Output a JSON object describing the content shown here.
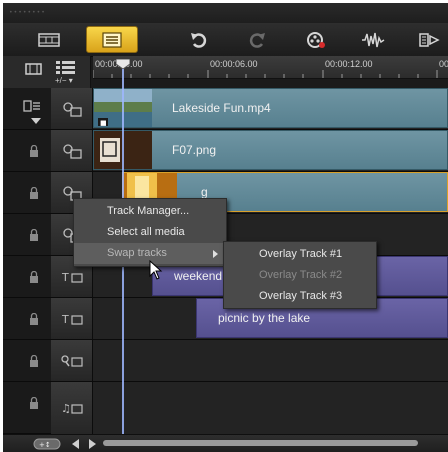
{
  "toolbar": {
    "buttons": [
      {
        "name": "storyboard-view-icon",
        "active": false
      },
      {
        "name": "timeline-view-icon",
        "active": true
      },
      {
        "name": "undo-icon",
        "active": false
      },
      {
        "name": "redo-icon",
        "active": false
      },
      {
        "name": "record-capture-icon",
        "active": false
      },
      {
        "name": "sound-mixer-icon",
        "active": false
      },
      {
        "name": "auto-music-icon",
        "active": false
      }
    ]
  },
  "ruler": {
    "add_remove_label": "+/− ▾",
    "timecodes": [
      "00:00:00.00",
      "00:00:06.00",
      "00:00:12.00",
      "00:"
    ]
  },
  "tracks": [
    {
      "id": "video",
      "clips": [
        {
          "label": "Lakeside Fun.mp4",
          "kind": "video"
        }
      ]
    },
    {
      "id": "overlay1",
      "clips": [
        {
          "label": "F07.png",
          "kind": "video"
        }
      ]
    },
    {
      "id": "overlay2",
      "clips": [
        {
          "label": "g",
          "kind": "video"
        }
      ]
    },
    {
      "id": "overlay3",
      "clips": []
    },
    {
      "id": "title1",
      "clips": [
        {
          "label": "weekend",
          "kind": "text"
        }
      ]
    },
    {
      "id": "title2",
      "clips": [
        {
          "label": "picnic by the lake",
          "kind": "text"
        }
      ]
    },
    {
      "id": "voice",
      "clips": []
    },
    {
      "id": "music",
      "clips": []
    }
  ],
  "context_menu": {
    "items": [
      {
        "label": "Track Manager...",
        "state": "normal"
      },
      {
        "label": "Select all media",
        "state": "normal"
      },
      {
        "label": "Swap tracks",
        "state": "highlighted",
        "has_submenu": true
      }
    ]
  },
  "submenu": {
    "items": [
      {
        "label": "Overlay Track #1",
        "state": "normal"
      },
      {
        "label": "Overlay Track #2",
        "state": "disabled"
      },
      {
        "label": "Overlay Track #3",
        "state": "normal"
      }
    ]
  },
  "colors": {
    "active_button": "#f0c232",
    "video_clip": "#6a909e",
    "title_clip": "#625ca0",
    "menu_bg": "#4a4a4a"
  }
}
